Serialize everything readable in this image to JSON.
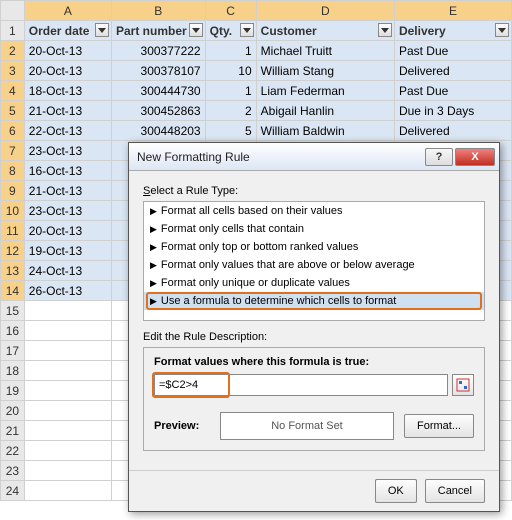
{
  "columns": [
    "A",
    "B",
    "C",
    "D",
    "E"
  ],
  "headers": {
    "A": "Order date",
    "B": "Part number",
    "C": "Qty.",
    "D": "Customer",
    "E": "Delivery"
  },
  "rows": [
    {
      "n": "1"
    },
    {
      "n": "2",
      "A": "20-Oct-13",
      "B": "300377222",
      "C": "1",
      "D": "Michael Truitt",
      "E": "Past Due",
      "sel": true
    },
    {
      "n": "3",
      "A": "20-Oct-13",
      "B": "300378107",
      "C": "10",
      "D": "William Stang",
      "E": "Delivered",
      "sel": true
    },
    {
      "n": "4",
      "A": "18-Oct-13",
      "B": "300444730",
      "C": "1",
      "D": "Liam Federman",
      "E": "Past Due",
      "sel": true
    },
    {
      "n": "5",
      "A": "21-Oct-13",
      "B": "300452863",
      "C": "2",
      "D": "Abigail Hanlin",
      "E": "Due in 3 Days",
      "sel": true
    },
    {
      "n": "6",
      "A": "22-Oct-13",
      "B": "300448203",
      "C": "5",
      "D": "William Baldwin",
      "E": "Delivered",
      "sel": true
    },
    {
      "n": "7",
      "A": "23-Oct-13",
      "sel": true
    },
    {
      "n": "8",
      "A": "16-Oct-13",
      "sel": true
    },
    {
      "n": "9",
      "A": "21-Oct-13",
      "sel": true
    },
    {
      "n": "10",
      "A": "23-Oct-13",
      "sel": true
    },
    {
      "n": "11",
      "A": "20-Oct-13",
      "sel": true
    },
    {
      "n": "12",
      "A": "19-Oct-13",
      "sel": true
    },
    {
      "n": "13",
      "A": "24-Oct-13",
      "sel": true
    },
    {
      "n": "14",
      "A": "26-Oct-13",
      "sel": true
    },
    {
      "n": "15"
    },
    {
      "n": "16"
    },
    {
      "n": "17"
    },
    {
      "n": "18"
    },
    {
      "n": "19"
    },
    {
      "n": "20"
    },
    {
      "n": "21"
    },
    {
      "n": "22"
    },
    {
      "n": "23"
    },
    {
      "n": "24"
    }
  ],
  "dialog": {
    "title": "New Formatting Rule",
    "help_glyph": "?",
    "close_glyph": "X",
    "select_label": "Select a Rule Type:",
    "rules": [
      "Format all cells based on their values",
      "Format only cells that contain",
      "Format only top or bottom ranked values",
      "Format only values that are above or below average",
      "Format only unique or duplicate values",
      "Use a formula to determine which cells to format"
    ],
    "selected_rule_index": 5,
    "edit_label": "Edit the Rule Description:",
    "formula_label": "Format values where this formula is true:",
    "formula_value": "=$C2>4",
    "preview_label": "Preview:",
    "preview_text": "No Format Set",
    "format_btn": "Format...",
    "ok_btn": "OK",
    "cancel_btn": "Cancel"
  }
}
